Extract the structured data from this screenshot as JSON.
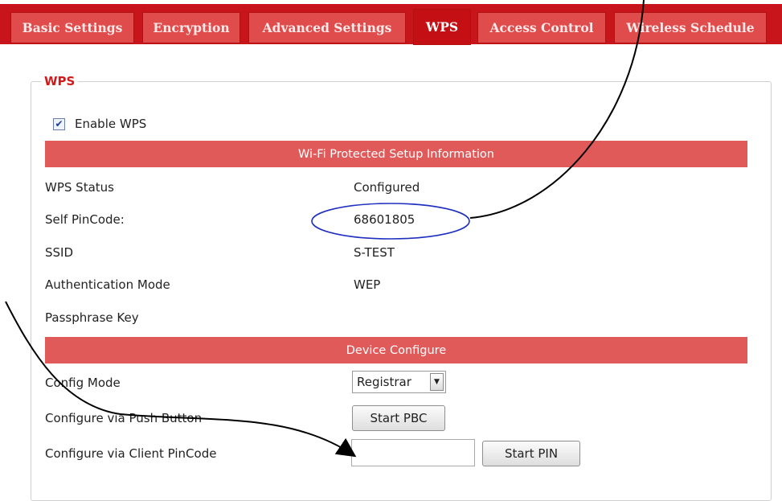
{
  "tabs": [
    {
      "label": "Basic Settings"
    },
    {
      "label": "Encryption"
    },
    {
      "label": "Advanced Settings"
    },
    {
      "label": "WPS"
    },
    {
      "label": "Access Control"
    },
    {
      "label": "Wireless Schedule"
    }
  ],
  "active_tab": "WPS",
  "section": {
    "legend": "WPS",
    "enable_label": "Enable WPS",
    "enable_checked": true
  },
  "info": {
    "header": "Wi-Fi Protected Setup Information",
    "rows": [
      {
        "label": "WPS Status",
        "value": "Configured"
      },
      {
        "label": "Self PinCode:",
        "value": "68601805"
      },
      {
        "label": "SSID",
        "value": "S-TEST"
      },
      {
        "label": "Authentication Mode",
        "value": "WEP"
      },
      {
        "label": "Passphrase Key",
        "value": ""
      }
    ]
  },
  "device": {
    "header": "Device Configure",
    "config_mode_label": "Config Mode",
    "config_mode_value": "Registrar",
    "push_button_label": "Configure via Push Button",
    "start_pbc": "Start PBC",
    "client_pin_label": "Configure via Client PinCode",
    "client_pin_value": "",
    "start_pin": "Start PIN"
  },
  "colors": {
    "tab_strip": "#c8141b",
    "tab": "#e04b4b",
    "section_bar": "#e15a5a",
    "legend_text": "#d11a1a",
    "annotation_ellipse": "#1f2fbf",
    "annotation_arrow": "#000000"
  }
}
